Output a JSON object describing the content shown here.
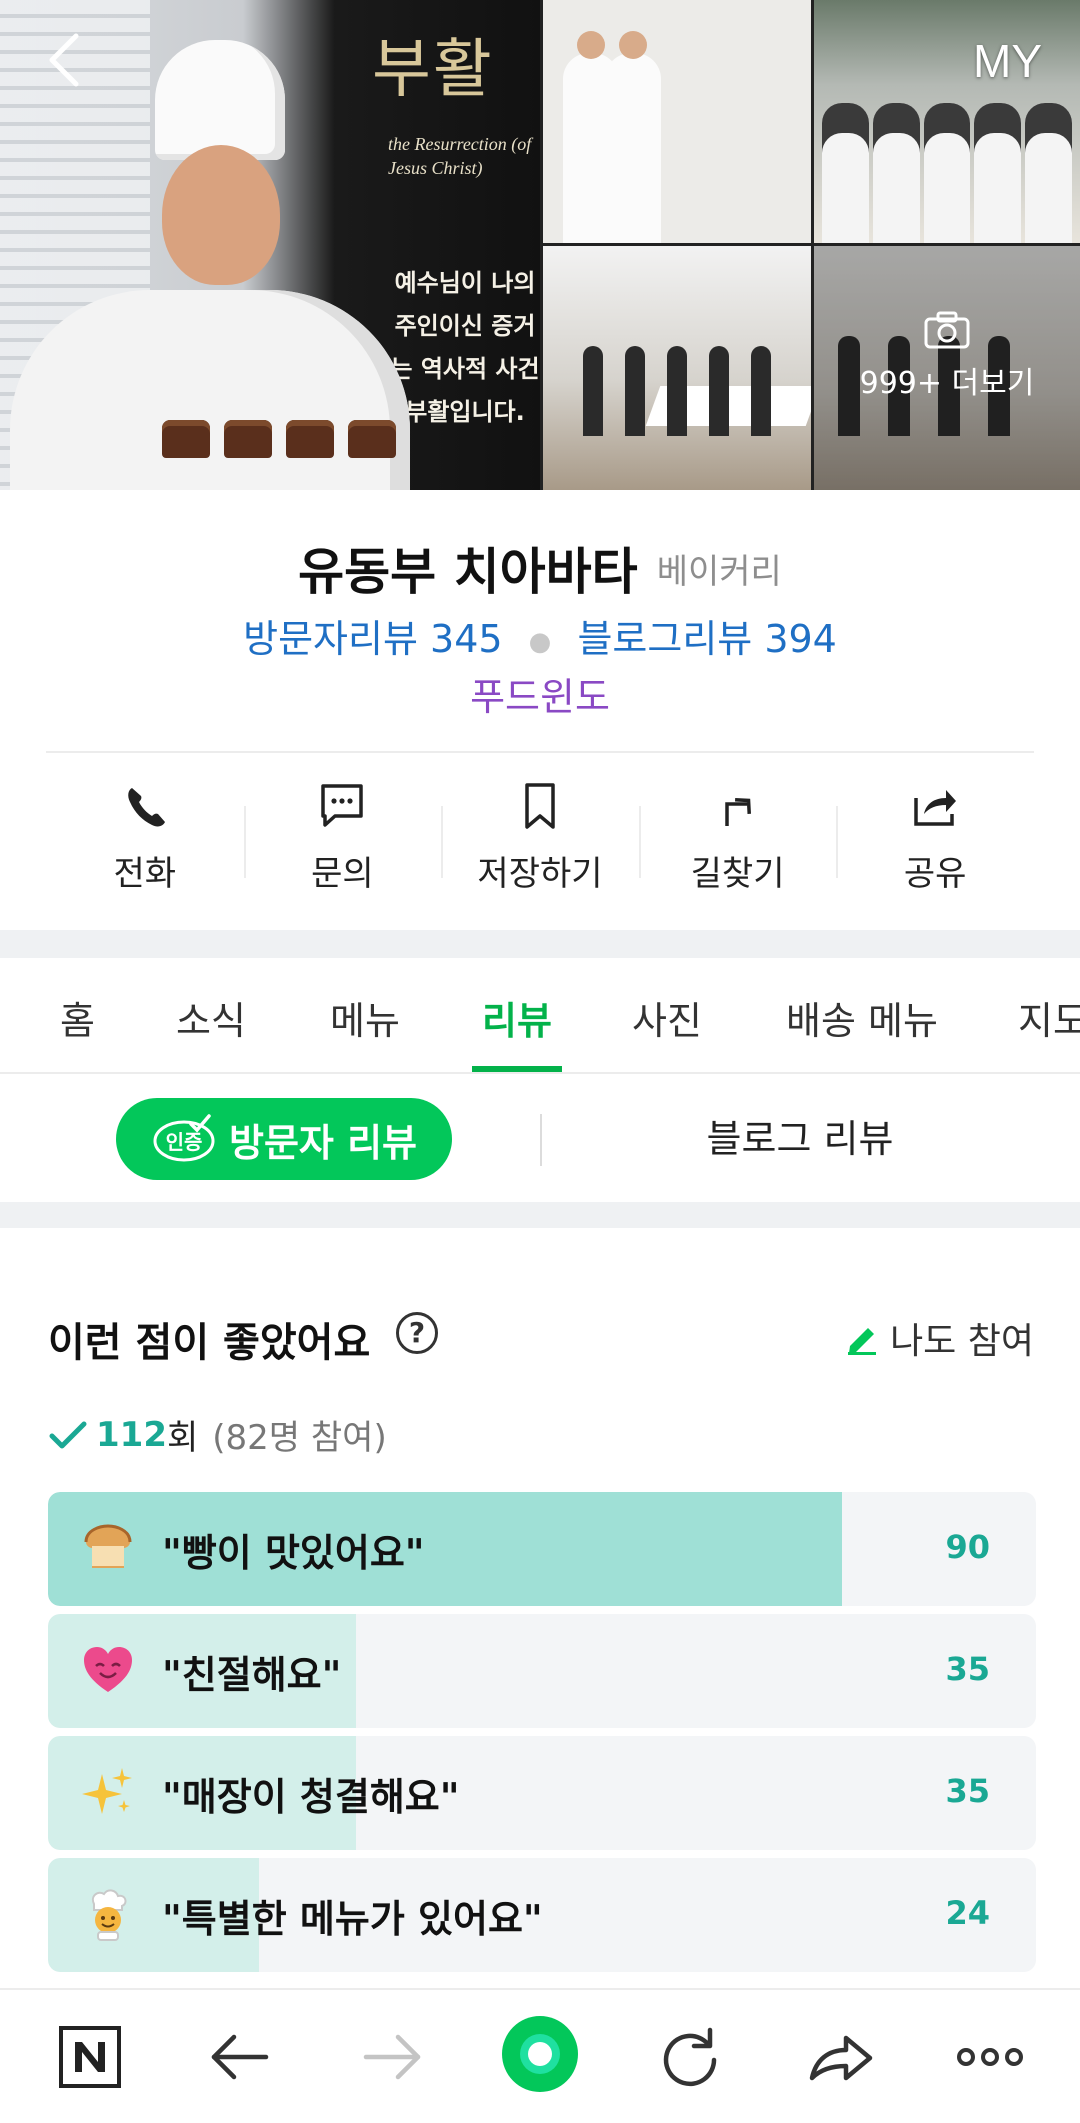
{
  "header": {
    "back_label": "back",
    "my_label": "MY",
    "photo_more_label": "999+ 더보기"
  },
  "photo_signage": {
    "title": "부활",
    "subtitle": "the Resurrection (of Jesus Christ)",
    "verse": "예수님이 나의 주인이신 증거는 역사적 사건 부활입니다."
  },
  "place": {
    "name": "유동부 치아바타",
    "category": "베이커리",
    "visitor_reviews": "방문자리뷰 345",
    "blog_reviews": "블로그리뷰 394",
    "badge": "푸드윈도"
  },
  "actions": [
    {
      "label": "전화",
      "icon": "phone-icon"
    },
    {
      "label": "문의",
      "icon": "chat-icon"
    },
    {
      "label": "저장하기",
      "icon": "bookmark-icon"
    },
    {
      "label": "길찾기",
      "icon": "directions-icon"
    },
    {
      "label": "공유",
      "icon": "share-icon"
    }
  ],
  "tabs": [
    "홈",
    "소식",
    "메뉴",
    "리뷰",
    "사진",
    "배송 메뉴",
    "지도"
  ],
  "active_tab": "리뷰",
  "review_tabs": {
    "visitor": "방문자 리뷰",
    "visitor_badge": "인증",
    "blog": "블로그 리뷰"
  },
  "keywords": {
    "heading": "이런 점이 좋았어요",
    "help_icon": "?",
    "join_label": "나도 참여",
    "total_count": "112",
    "total_unit": "회",
    "participants": "(82명 참여)",
    "items": [
      {
        "emoji": "bread-icon",
        "label": "\"빵이 맛있어요\"",
        "count": "90",
        "ratio": 0.804
      },
      {
        "emoji": "heart-face-icon",
        "label": "\"친절해요\"",
        "count": "35",
        "ratio": 0.312
      },
      {
        "emoji": "sparkles-icon",
        "label": "\"매장이 청결해요\"",
        "count": "35",
        "ratio": 0.312
      },
      {
        "emoji": "chef-icon",
        "label": "\"특별한 메뉴가 있어요\"",
        "count": "24",
        "ratio": 0.214
      }
    ]
  },
  "colors": {
    "accent_green": "#03c75a",
    "tab_green": "#03b24a",
    "count_teal": "#1aa894",
    "link_blue": "#1f6fc4",
    "badge_purple": "#8a49c4",
    "bar_top": "#9fe0d6",
    "bar_rest": "#d3efea"
  },
  "bottom_bar": [
    "naver-n-icon",
    "back-arrow-icon",
    "forward-arrow-icon",
    "home-green-icon",
    "refresh-icon",
    "share-arrow-icon",
    "more-dots-icon"
  ]
}
